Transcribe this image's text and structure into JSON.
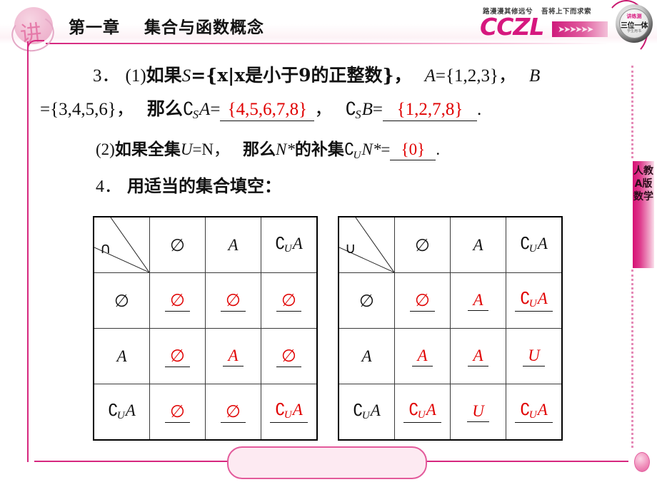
{
  "header": {
    "chapter": "第一章",
    "title": "集合与函数概念",
    "motto_left": "路漫漫其修远兮",
    "motto_right": "吾将上下而求索",
    "logo_text": "CCZL",
    "stamp_glyph": "讲",
    "badge_top": "讲练测",
    "badge_main": "三位一体",
    "badge_sub": "学生用书"
  },
  "sidebar": {
    "label": "人教A版数学"
  },
  "questions": {
    "q3": {
      "number": "3",
      "part1_label": "(1)",
      "line1_prefix": "如果",
      "set_S": "S",
      "set_S_def": "={x|x是小于9的正整数}，",
      "set_A": "A",
      "set_A_def": "={1,2,3}，",
      "set_B": "B",
      "line2_B_def": "={3,4,5,6}，",
      "line2_then": "那么",
      "comp_base_S": "S",
      "comp_arg_A": "A",
      "eq": "=",
      "answer_CsA": "{4,5,6,7,8}",
      "comma": "，",
      "comp_arg_B": "B",
      "answer_CsB": "{1,2,7,8}",
      "period": ".",
      "part2_label": "(2)",
      "p2_prefix": "如果全集",
      "p2_U": "U",
      "p2_eq_N": "=N，",
      "p2_then": "那么",
      "p2_Nstar": "N*",
      "p2_mid": "的补集",
      "comp_base_U": "U",
      "comp_arg_Nstar": "N*",
      "answer_CuN": "{0}"
    },
    "q4": {
      "number": "4",
      "text": "用适当的集合填空："
    }
  },
  "tables": [
    {
      "id": "intersection-table",
      "operator": "∩",
      "col_headers": [
        "∅",
        "A",
        "∁UA"
      ],
      "row_headers": [
        "∅",
        "A",
        "∁UA"
      ],
      "cells": [
        [
          {
            "text": "∅",
            "kind": "emptyset"
          },
          {
            "text": "∅",
            "kind": "emptyset"
          },
          {
            "text": "∅",
            "kind": "emptyset"
          }
        ],
        [
          {
            "text": "∅",
            "kind": "emptyset"
          },
          {
            "text": "A",
            "kind": "ital"
          },
          {
            "text": "∅",
            "kind": "emptyset"
          }
        ],
        [
          {
            "text": "∅",
            "kind": "emptyset"
          },
          {
            "text": "∅",
            "kind": "emptyset"
          },
          {
            "text": "∁UA",
            "kind": "comp"
          }
        ]
      ]
    },
    {
      "id": "union-table",
      "operator": "∪",
      "col_headers": [
        "∅",
        "A",
        "∁UA"
      ],
      "row_headers": [
        "∅",
        "A",
        "∁UA"
      ],
      "cells": [
        [
          {
            "text": "∅",
            "kind": "emptyset"
          },
          {
            "text": "A",
            "kind": "ital"
          },
          {
            "text": "∁UA",
            "kind": "comp"
          }
        ],
        [
          {
            "text": "A",
            "kind": "ital"
          },
          {
            "text": "A",
            "kind": "ital"
          },
          {
            "text": "U",
            "kind": "ital"
          }
        ],
        [
          {
            "text": "∁UA",
            "kind": "comp"
          },
          {
            "text": "U",
            "kind": "ital"
          },
          {
            "text": "∁UA",
            "kind": "comp"
          }
        ]
      ]
    }
  ],
  "colors": {
    "accent_pink": "#d6277f",
    "answer_red": "#e00000",
    "text_black": "#111111"
  }
}
